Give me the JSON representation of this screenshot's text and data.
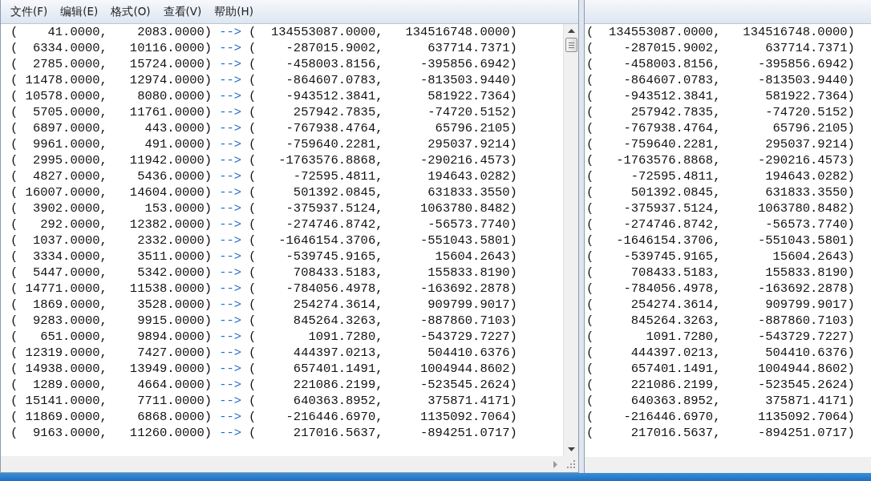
{
  "menu": [
    "文件(F)",
    "编辑(E)",
    "格式(O)",
    "查看(V)",
    "帮助(H)"
  ],
  "left_window": {
    "rows": [
      {
        "input": [
          "(",
          "41.0000,",
          "2083.0000)"
        ],
        "arrow": "-->",
        "output": [
          "(",
          "134553087.0000,",
          "134516748.0000)"
        ]
      },
      {
        "input": [
          "(",
          "6334.0000,",
          "10116.0000)"
        ],
        "arrow": "-->",
        "output": [
          "(",
          "-287015.9002,",
          "637714.7371)"
        ]
      },
      {
        "input": [
          "(",
          "2785.0000,",
          "15724.0000)"
        ],
        "arrow": "-->",
        "output": [
          "(",
          "-458003.8156,",
          "-395856.6942)"
        ]
      },
      {
        "input": [
          "(",
          "11478.0000,",
          "12974.0000)"
        ],
        "arrow": "-->",
        "output": [
          "(",
          "-864607.0783,",
          "-813503.9440)"
        ]
      },
      {
        "input": [
          "(",
          "10578.0000,",
          "8080.0000)"
        ],
        "arrow": "-->",
        "output": [
          "(",
          "-943512.3841,",
          "581922.7364)"
        ]
      },
      {
        "input": [
          "(",
          "5705.0000,",
          "11761.0000)"
        ],
        "arrow": "-->",
        "output": [
          "(",
          "257942.7835,",
          "-74720.5152)"
        ]
      },
      {
        "input": [
          "(",
          "6897.0000,",
          "443.0000)"
        ],
        "arrow": "-->",
        "output": [
          "(",
          "-767938.4764,",
          "65796.2105)"
        ]
      },
      {
        "input": [
          "(",
          "9961.0000,",
          "491.0000)"
        ],
        "arrow": "-->",
        "output": [
          "(",
          "-759640.2281,",
          "295037.9214)"
        ]
      },
      {
        "input": [
          "(",
          "2995.0000,",
          "11942.0000)"
        ],
        "arrow": "-->",
        "output": [
          "(",
          "-1763576.8868,",
          "-290216.4573)"
        ]
      },
      {
        "input": [
          "(",
          "4827.0000,",
          "5436.0000)"
        ],
        "arrow": "-->",
        "output": [
          "(",
          "-72595.4811,",
          "194643.0282)"
        ]
      },
      {
        "input": [
          "(",
          "16007.0000,",
          "14604.0000)"
        ],
        "arrow": "-->",
        "output": [
          "(",
          "501392.0845,",
          "631833.3550)"
        ]
      },
      {
        "input": [
          "(",
          "3902.0000,",
          "153.0000)"
        ],
        "arrow": "-->",
        "output": [
          "(",
          "-375937.5124,",
          "1063780.8482)"
        ]
      },
      {
        "input": [
          "(",
          "292.0000,",
          "12382.0000)"
        ],
        "arrow": "-->",
        "output": [
          "(",
          "-274746.8742,",
          "-56573.7740)"
        ]
      },
      {
        "input": [
          "(",
          "1037.0000,",
          "2332.0000)"
        ],
        "arrow": "-->",
        "output": [
          "(",
          "-1646154.3706,",
          "-551043.5801)"
        ]
      },
      {
        "input": [
          "(",
          "3334.0000,",
          "3511.0000)"
        ],
        "arrow": "-->",
        "output": [
          "(",
          "-539745.9165,",
          "15604.2643)"
        ]
      },
      {
        "input": [
          "(",
          "5447.0000,",
          "5342.0000)"
        ],
        "arrow": "-->",
        "output": [
          "(",
          "708433.5183,",
          "155833.8190)"
        ]
      },
      {
        "input": [
          "(",
          "14771.0000,",
          "11538.0000)"
        ],
        "arrow": "-->",
        "output": [
          "(",
          "-784056.4978,",
          "-163692.2878)"
        ]
      },
      {
        "input": [
          "(",
          "1869.0000,",
          "3528.0000)"
        ],
        "arrow": "-->",
        "output": [
          "(",
          "254274.3614,",
          "909799.9017)"
        ]
      },
      {
        "input": [
          "(",
          "9283.0000,",
          "9915.0000)"
        ],
        "arrow": "-->",
        "output": [
          "(",
          "845264.3263,",
          "-887860.7103)"
        ]
      },
      {
        "input": [
          "(",
          "651.0000,",
          "9894.0000)"
        ],
        "arrow": "-->",
        "output": [
          "(",
          "1091.7280,",
          "-543729.7227)"
        ]
      },
      {
        "input": [
          "(",
          "12319.0000,",
          "7427.0000)"
        ],
        "arrow": "-->",
        "output": [
          "(",
          "444397.0213,",
          "504410.6376)"
        ]
      },
      {
        "input": [
          "(",
          "14938.0000,",
          "13949.0000)"
        ],
        "arrow": "-->",
        "output": [
          "(",
          "657401.1491,",
          "1004944.8602)"
        ]
      },
      {
        "input": [
          "(",
          "1289.0000,",
          "4664.0000)"
        ],
        "arrow": "-->",
        "output": [
          "(",
          "221086.2199,",
          "-523545.2624)"
        ]
      },
      {
        "input": [
          "(",
          "15141.0000,",
          "7711.0000)"
        ],
        "arrow": "-->",
        "output": [
          "(",
          "640363.8952,",
          "375871.4171)"
        ]
      },
      {
        "input": [
          "(",
          "11869.0000,",
          "6868.0000)"
        ],
        "arrow": "-->",
        "output": [
          "(",
          "-216446.6970,",
          "1135092.7064)"
        ]
      },
      {
        "input": [
          "(",
          "9163.0000,",
          "11260.0000)"
        ],
        "arrow": "-->",
        "output": [
          "(",
          "217016.5637,",
          "-894251.0717)"
        ]
      }
    ]
  },
  "right_window": {
    "rows": [
      {
        "values": [
          "(",
          "134553087.0000,",
          "134516748.0000)"
        ]
      },
      {
        "values": [
          "(",
          "-287015.9002,",
          "637714.7371)"
        ]
      },
      {
        "values": [
          "(",
          "-458003.8156,",
          "-395856.6942)"
        ]
      },
      {
        "values": [
          "(",
          "-864607.0783,",
          "-813503.9440)"
        ]
      },
      {
        "values": [
          "(",
          "-943512.3841,",
          "581922.7364)"
        ]
      },
      {
        "values": [
          "(",
          "257942.7835,",
          "-74720.5152)"
        ]
      },
      {
        "values": [
          "(",
          "-767938.4764,",
          "65796.2105)"
        ]
      },
      {
        "values": [
          "(",
          "-759640.2281,",
          "295037.9214)"
        ]
      },
      {
        "values": [
          "(",
          "-1763576.8868,",
          "-290216.4573)"
        ]
      },
      {
        "values": [
          "(",
          "-72595.4811,",
          "194643.0282)"
        ]
      },
      {
        "values": [
          "(",
          "501392.0845,",
          "631833.3550)"
        ]
      },
      {
        "values": [
          "(",
          "-375937.5124,",
          "1063780.8482)"
        ]
      },
      {
        "values": [
          "(",
          "-274746.8742,",
          "-56573.7740)"
        ]
      },
      {
        "values": [
          "(",
          "-1646154.3706,",
          "-551043.5801)"
        ]
      },
      {
        "values": [
          "(",
          "-539745.9165,",
          "15604.2643)"
        ]
      },
      {
        "values": [
          "(",
          "708433.5183,",
          "155833.8190)"
        ]
      },
      {
        "values": [
          "(",
          "-784056.4978,",
          "-163692.2878)"
        ]
      },
      {
        "values": [
          "(",
          "254274.3614,",
          "909799.9017)"
        ]
      },
      {
        "values": [
          "(",
          "845264.3263,",
          "-887860.7103)"
        ]
      },
      {
        "values": [
          "(",
          "1091.7280,",
          "-543729.7227)"
        ]
      },
      {
        "values": [
          "(",
          "444397.0213,",
          "504410.6376)"
        ]
      },
      {
        "values": [
          "(",
          "657401.1491,",
          "1004944.8602)"
        ]
      },
      {
        "values": [
          "(",
          "221086.2199,",
          "-523545.2624)"
        ]
      },
      {
        "values": [
          "(",
          "640363.8952,",
          "375871.4171)"
        ]
      },
      {
        "values": [
          "(",
          "-216446.6970,",
          "1135092.7064)"
        ]
      },
      {
        "values": [
          "(",
          "217016.5637,",
          "-894251.0717)"
        ]
      }
    ]
  }
}
